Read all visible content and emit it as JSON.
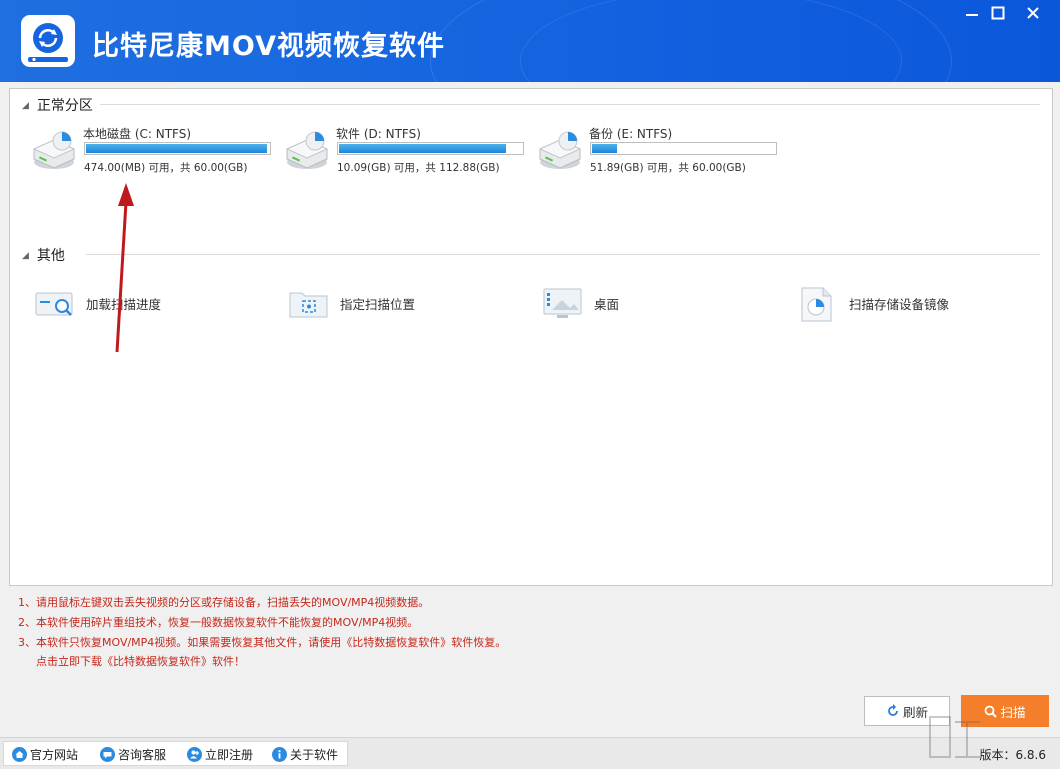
{
  "app": {
    "title": "比特尼康MOV视频恢复软件",
    "brand_color": "#1565e0",
    "window_controls": [
      "minimize-icon",
      "maximize-icon",
      "close-icon"
    ]
  },
  "sections": {
    "normal_partitions": "正常分区",
    "other": "其他"
  },
  "drives": [
    {
      "name": "本地磁盘 (C: NTFS)",
      "free_text": "474.00(MB) 可用，共 60.00(GB)",
      "used_fraction": 0.99
    },
    {
      "name": "软件 (D: NTFS)",
      "free_text": "10.09(GB) 可用，共 112.88(GB)",
      "used_fraction": 0.91
    },
    {
      "name": "备份 (E: NTFS)",
      "free_text": "51.89(GB) 可用，共 60.00(GB)",
      "used_fraction": 0.135
    }
  ],
  "other_items": [
    {
      "label": "加载扫描进度",
      "icon": "load-scan-progress-icon"
    },
    {
      "label": "指定扫描位置",
      "icon": "folder-target-icon"
    },
    {
      "label": "桌面",
      "icon": "desktop-icon"
    },
    {
      "label": "扫描存储设备镜像",
      "icon": "disk-image-icon"
    }
  ],
  "notes": [
    "1、请用鼠标左键双击丢失视频的分区或存储设备，扫描丢失的MOV/MP4视频数据。",
    "2、本软件使用碎片重组技术，恢复一般数据恢复软件不能恢复的MOV/MP4视频。",
    "3、本软件只恢复MOV/MP4视频。如果需要恢复其他文件，请使用《比特数据恢复软件》软件恢复。",
    "点击立即下载《比特数据恢复软件》软件！"
  ],
  "buttons": {
    "refresh": "刷新",
    "scan": "扫描",
    "scan_color": "#f57e2a"
  },
  "statusbar": {
    "links": [
      "官方网站",
      "咨询客服",
      "立即注册",
      "关于软件"
    ],
    "version": "版本：6.8.6"
  }
}
